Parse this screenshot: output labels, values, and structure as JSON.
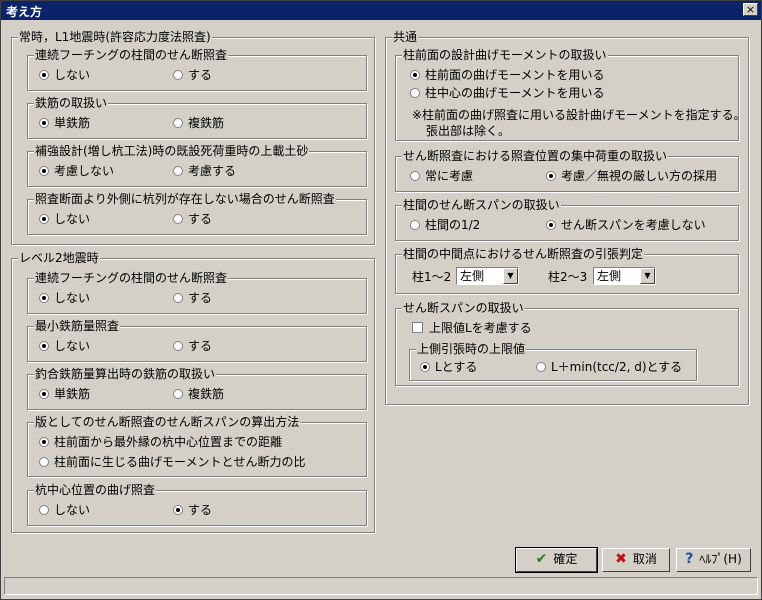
{
  "window": {
    "title": "考え方",
    "close_label": "×"
  },
  "left_top_group": {
    "title": "常時，L1地震時(許容応力度法照査)",
    "sub": [
      {
        "title": "連続フーチングの柱間のせん断照査",
        "opt1": "しない",
        "opt2": "する"
      },
      {
        "title": "鉄筋の取扱い",
        "opt1": "単鉄筋",
        "opt2": "複鉄筋"
      },
      {
        "title": "補強設計(増し杭工法)時の既設死荷重時の上載土砂",
        "opt1": "考慮しない",
        "opt2": "考慮する"
      },
      {
        "title": "照査断面より外側に杭列が存在しない場合のせん断照査",
        "opt1": "しない",
        "opt2": "する"
      }
    ]
  },
  "left_bottom_group": {
    "title": "レベル2地震時",
    "sub": [
      {
        "title": "連続フーチングの柱間のせん断照査",
        "opt1": "しない",
        "opt2": "する"
      },
      {
        "title": "最小鉄筋量照査",
        "opt1": "しない",
        "opt2": "する"
      },
      {
        "title": "釣合鉄筋量算出時の鉄筋の取扱い",
        "opt1": "単鉄筋",
        "opt2": "複鉄筋"
      },
      {
        "title": "版としてのせん断照査のせん断スパンの算出方法",
        "opt1": "柱前面から最外縁の杭中心位置までの距離",
        "opt2": "柱前面に生じる曲げモーメントとせん断力の比"
      },
      {
        "title": "杭中心位置の曲げ照査",
        "opt1": "しない",
        "opt2": "する"
      }
    ]
  },
  "right_group": {
    "title": "共通",
    "moment": {
      "title": "柱前面の設計曲げモーメントの取扱い",
      "opt1": "柱前面の曲げモーメントを用いる",
      "opt2": "柱中心の曲げモーメントを用いる",
      "note1": "※柱前面の曲げ照査に用いる設計曲げモーメントを指定する。",
      "note2": "張出部は除く。"
    },
    "concentrated": {
      "title": "せん断照査における照査位置の集中荷重の取扱い",
      "opt1": "常に考慮",
      "opt2": "考慮／無視の厳しい方の採用"
    },
    "column_span": {
      "title": "柱間のせん断スパンの取扱い",
      "opt1": "柱間の1/2",
      "opt2": "せん断スパンを考慮しない"
    },
    "midpoint": {
      "title": "柱間の中間点におけるせん断照査の引張判定",
      "label1": "柱1～2",
      "value1": "左側",
      "label2": "柱2～3",
      "value2": "左側"
    },
    "shear_span": {
      "title": "せん断スパンの取扱い",
      "checkbox": "上限値Lを考慮する",
      "inner_title": "上側引張時の上限値",
      "opt1": "Lとする",
      "opt2": "L＋min(tcc/2, d)とする"
    }
  },
  "buttons": {
    "ok": "確定",
    "cancel": "取消",
    "help": "ﾍﾙﾌﾟ(H)"
  }
}
